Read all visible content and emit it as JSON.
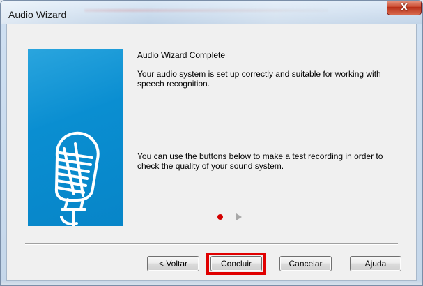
{
  "window": {
    "title": "Audio Wizard",
    "close_label": "X"
  },
  "content": {
    "heading": "Audio Wizard Complete",
    "paragraph1": "Your audio system is set up correctly and suitable for working with speech recognition.",
    "paragraph2": "You can use the buttons below to make a test recording in order to check the quality of your sound system."
  },
  "icons": {
    "banner": "microphone-icon",
    "progress_current": "progress-dot-icon",
    "progress_next": "next-arrow-icon",
    "close": "close-icon"
  },
  "buttons": {
    "back": "< Voltar",
    "finish": "Concluir",
    "cancel": "Cancelar",
    "help": "Ajuda"
  },
  "colors": {
    "banner_blue": "#0a8ed1",
    "progress_red": "#d40000",
    "highlight_red": "#e00000"
  }
}
